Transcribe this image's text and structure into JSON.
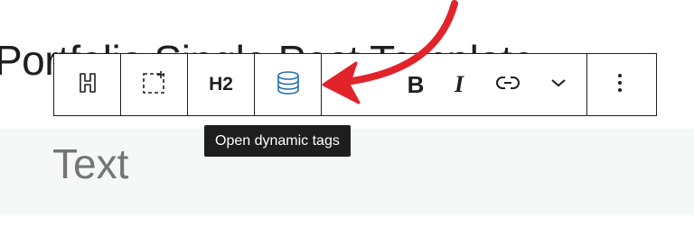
{
  "editor": {
    "heading_text": "Portfolio Single Post Template",
    "placeholder_text": "Text"
  },
  "toolbar": {
    "heading_type_icon": "heading-block-icon",
    "select_parent_icon": "select-parent-icon",
    "heading_level_label": "H2",
    "dynamic_tags_icon": "database-icon",
    "bold_label": "B",
    "italic_label": "I",
    "link_icon": "link-icon",
    "more_formats_icon": "chevron-down-icon",
    "options_icon": "vertical-ellipsis-icon"
  },
  "tooltip": {
    "text": "Open dynamic tags"
  },
  "annotation": {
    "arrow_color": "#e2232a"
  },
  "colors": {
    "accent": "#3858e9",
    "dynamic_icon": "#2271b1",
    "text_dark": "#1e1e1e",
    "placeholder": "#757575",
    "block_bg": "#f6f7f7"
  }
}
